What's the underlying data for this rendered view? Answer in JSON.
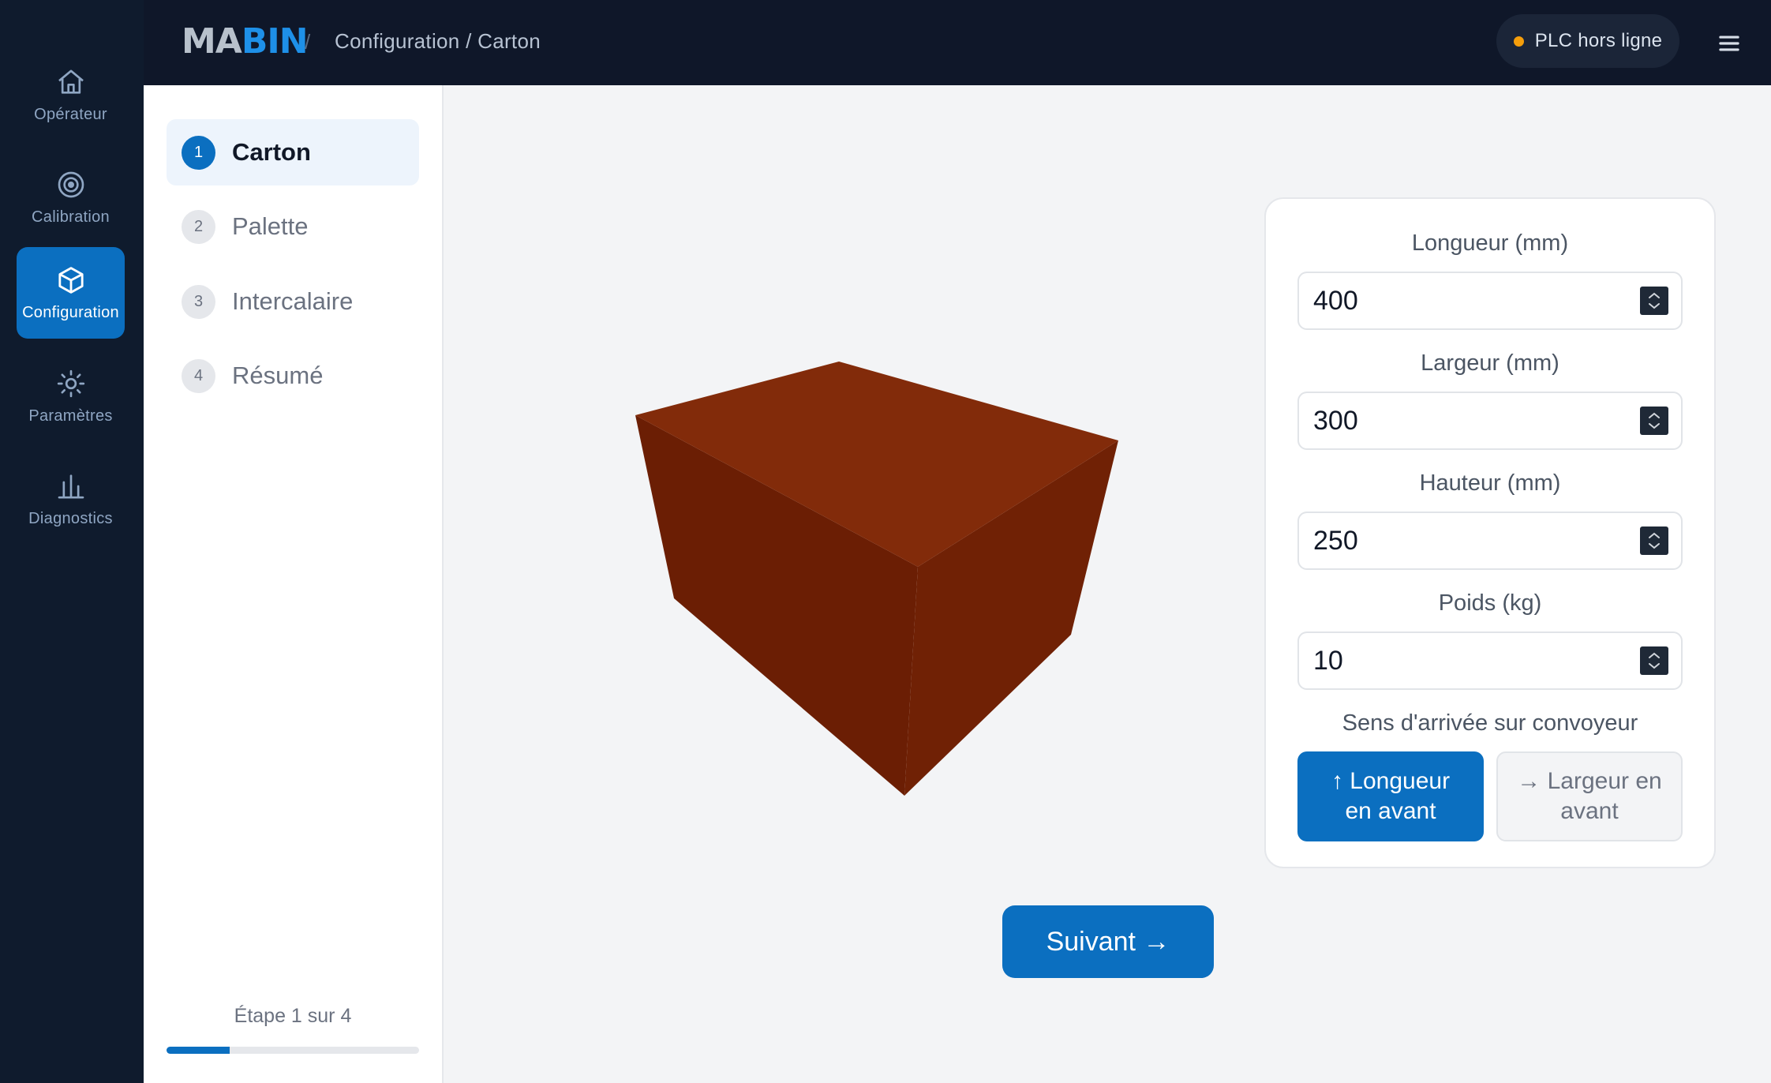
{
  "app": {
    "logo": {
      "part1": "MA",
      "part2": "BIN"
    },
    "breadcrumb_sep": "/",
    "breadcrumb": "Configuration / Carton"
  },
  "status": {
    "plc_label": "PLC hors ligne",
    "plc_color": "#f59e0b"
  },
  "nav": {
    "items": [
      {
        "label": "Opérateur",
        "icon": "home-icon"
      },
      {
        "label": "Calibration",
        "icon": "target-icon"
      },
      {
        "label": "Configuration",
        "icon": "cube-icon",
        "active": true
      },
      {
        "label": "Paramètres",
        "icon": "sun-gear-icon"
      },
      {
        "label": "Diagnostics",
        "icon": "bar-chart-icon"
      }
    ]
  },
  "steps": {
    "items": [
      {
        "num": "1",
        "label": "Carton",
        "active": true
      },
      {
        "num": "2",
        "label": "Palette"
      },
      {
        "num": "3",
        "label": "Intercalaire"
      },
      {
        "num": "4",
        "label": "Résumé"
      }
    ],
    "footer": "Étape 1 sur 4",
    "progress_fraction": 0.25
  },
  "form": {
    "length_label": "Longueur (mm)",
    "length_value": "400",
    "width_label": "Largeur (mm)",
    "width_value": "300",
    "height_label": "Hauteur (mm)",
    "height_value": "250",
    "weight_label": "Poids (kg)",
    "weight_value": "10",
    "direction_label": "Sens d'arrivée sur convoyeur",
    "dir_length_line1": "↑ Longueur",
    "dir_length_line2": "en avant",
    "dir_width_line1": "→ Largeur en",
    "dir_width_line2": "avant"
  },
  "actions": {
    "next_label": "Suivant →"
  },
  "colors": {
    "accent": "#0b6fc0",
    "box_top": "#822b0a",
    "box_left": "#6b1e04",
    "box_right": "#702105"
  }
}
